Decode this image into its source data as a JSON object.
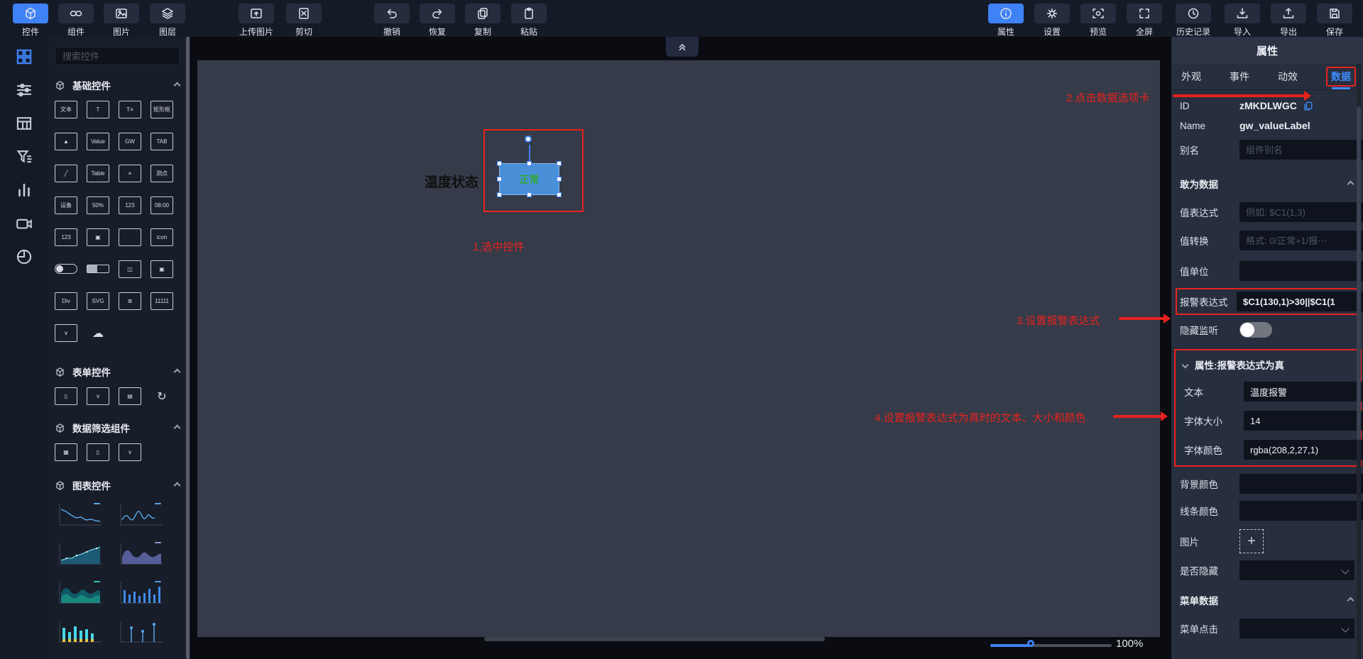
{
  "app": {
    "zoom_level": "100%"
  },
  "colors": {
    "accent": "#3e82f6",
    "annotation_red": "#e8221d",
    "alarm_red": "#d0021b",
    "widget_blue": "#4a90d9",
    "widget_text_green": "#2fa838"
  },
  "toolbar": {
    "left": [
      {
        "label": "控件",
        "active": true
      },
      {
        "label": "组件"
      },
      {
        "label": "图片"
      },
      {
        "label": "图层"
      },
      {
        "label": "上传图片"
      },
      {
        "label": "剪切"
      },
      {
        "label": "撤销"
      },
      {
        "label": "恢复"
      },
      {
        "label": "复制"
      },
      {
        "label": "粘贴"
      }
    ],
    "right": [
      {
        "label": "属性",
        "active": true
      },
      {
        "label": "设置"
      },
      {
        "label": "预览"
      },
      {
        "label": "全屏"
      },
      {
        "label": "历史记录"
      },
      {
        "label": "导入"
      },
      {
        "label": "导出"
      },
      {
        "label": "保存"
      }
    ]
  },
  "left_panel": {
    "search_placeholder": "搜索控件",
    "section_basic": "基础控件",
    "section_form": "表单控件",
    "section_filter": "数据筛选组件",
    "section_chart": "图表控件",
    "basic_widgets": [
      {
        "g": "文本",
        "n": "widget-text-frame"
      },
      {
        "g": "T",
        "n": "widget-text-edit"
      },
      {
        "g": "T≡",
        "n": "widget-text-lines"
      },
      {
        "g": "矩形框",
        "n": "widget-rect-frame"
      },
      {
        "g": "▲",
        "n": "widget-image"
      },
      {
        "g": "Value",
        "n": "widget-value"
      },
      {
        "g": "GW",
        "n": "widget-gw"
      },
      {
        "g": "TAB",
        "n": "widget-tab"
      },
      {
        "g": "╱",
        "n": "widget-line"
      },
      {
        "g": "Table",
        "n": "widget-table"
      },
      {
        "g": "≡",
        "n": "widget-alarm-list"
      },
      {
        "g": "测点",
        "n": "widget-measure-table"
      },
      {
        "g": "设备",
        "n": "widget-device-table"
      },
      {
        "g": "50%",
        "n": "widget-percent"
      },
      {
        "g": "123",
        "n": "widget-number"
      },
      {
        "g": "08:00",
        "n": "widget-clock"
      },
      {
        "g": "123",
        "n": "widget-number-anim"
      },
      {
        "g": "▣",
        "n": "widget-carousel"
      },
      {
        "g": "",
        "n": "widget-rect"
      },
      {
        "g": "icon",
        "n": "widget-icon"
      },
      {
        "g": "",
        "n": "widget-toggle",
        "c": "pill"
      },
      {
        "g": "",
        "n": "widget-progress",
        "c": "prog"
      },
      {
        "g": "◫",
        "n": "widget-layout"
      },
      {
        "g": "▣",
        "n": "widget-images"
      },
      {
        "g": "Div",
        "n": "widget-div"
      },
      {
        "g": "SVG",
        "n": "widget-svg"
      },
      {
        "g": "≣",
        "n": "widget-drawer"
      },
      {
        "g": "11111",
        "n": "widget-digits"
      },
      {
        "g": "∨",
        "n": "widget-select"
      },
      {
        "g": "☁",
        "n": "widget-weather",
        "c": "bare"
      }
    ],
    "form_widgets": [
      {
        "g": "▯",
        "n": "form-input"
      },
      {
        "g": "∨",
        "n": "form-select"
      },
      {
        "g": "▤",
        "n": "form-save"
      },
      {
        "g": "↻",
        "n": "form-refresh",
        "c": "bare"
      }
    ],
    "filter_widgets": [
      {
        "g": "▦",
        "n": "filter-date"
      },
      {
        "g": "▯",
        "n": "filter-input"
      },
      {
        "g": "∨",
        "n": "filter-select"
      }
    ],
    "chart_widgets": [
      "line-down",
      "line-wave",
      "area-up",
      "area-wave",
      "dual-area",
      "bars",
      "stacked-bars",
      "lollipop"
    ]
  },
  "canvas": {
    "device_label": "温度状态",
    "widget_text": "正常"
  },
  "annotations": {
    "step1": "1,选中控件",
    "step2": "2.点击数据选项卡",
    "step3": "3.设置报警表达式",
    "step4": "4.设置报警表达式为真时的文本、大小和颜色"
  },
  "statusbar": {
    "zoom": "100%"
  },
  "properties": {
    "title": "属性",
    "tabs": [
      {
        "label": "外观"
      },
      {
        "label": "事件"
      },
      {
        "label": "动效"
      },
      {
        "label": "数据",
        "active": true
      }
    ],
    "id_label": "ID",
    "id_value": "zMKDLWGC",
    "name_label": "Name",
    "name_value": "gw_valueLabel",
    "alias_label": "别名",
    "alias_placeholder": "组件别名",
    "data_section_title": "敢为数据",
    "value_expr_label": "值表达式",
    "value_expr_placeholder": "例如: $C1(1,3)",
    "value_convert_label": "值转换",
    "value_convert_placeholder": "格式: 0/正常+1/报⋯",
    "value_unit_label": "值单位",
    "alarm_expr_label": "报警表达式",
    "alarm_expr_value": "$C1(130,1)>30||$C1(1",
    "hide_listen_label": "隐藏监听",
    "alarm_true_section_title": "属性:报警表达式为真",
    "text_label": "文本",
    "text_value": "温度报警",
    "font_size_label": "字体大小",
    "font_size_value": "14",
    "font_color_label": "字体颜色",
    "font_color_value": "rgba(208,2,27,1)",
    "bg_color_label": "背景颜色",
    "line_color_label": "线条颜色",
    "image_label": "图片",
    "hidden_label": "是否隐藏",
    "menu_section_title": "菜单数据",
    "menu_click_label": "菜单点击"
  }
}
